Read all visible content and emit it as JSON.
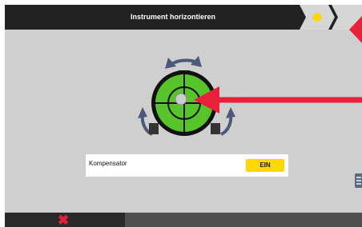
{
  "header": {
    "title": "Instrument horizontieren"
  },
  "compensator": {
    "label": "Kompensator",
    "button_label": "EIN"
  },
  "colors": {
    "accent": "#ffd700",
    "arrow": "#e8203a",
    "bubble": "#57c42c",
    "cancel": "#e8203a"
  },
  "icons": {
    "cancel": "cancel-x-icon",
    "status": "yellow-dot-icon"
  }
}
